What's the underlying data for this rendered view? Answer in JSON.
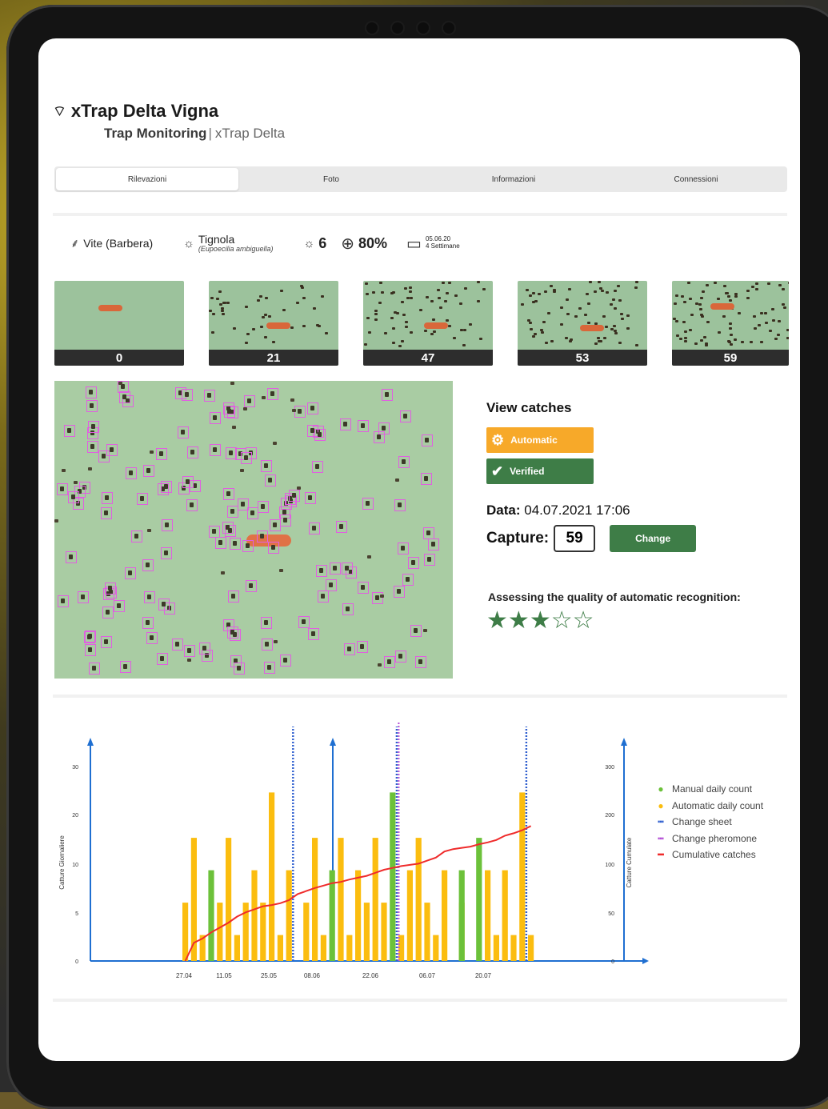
{
  "app": {
    "title": "xTrap Delta Vigna",
    "section": "Trap Monitoring",
    "device": "xTrap Delta"
  },
  "tabs": [
    {
      "label": "Rilevazioni",
      "active": true
    },
    {
      "label": "Foto",
      "active": false
    },
    {
      "label": "Informazioni",
      "active": false
    },
    {
      "label": "Connessioni",
      "active": false
    }
  ],
  "info": {
    "crop": "Vite (Barbera)",
    "pest_name": "Tignola",
    "pest_latin": "(Eupoecilia ambiguella)",
    "pest_count": "6",
    "battery": "80%",
    "date_line1": "05.06.20",
    "date_line2": "4 Settimane"
  },
  "thumbnails": [
    {
      "count": "0"
    },
    {
      "count": "21"
    },
    {
      "count": "47"
    },
    {
      "count": "53"
    },
    {
      "count": "59"
    }
  ],
  "panel": {
    "heading": "View catches",
    "auto_label": "Automatic",
    "verified_label": "Verified",
    "data_label": "Data:",
    "data_value": "04.07.2021 17:06",
    "capture_label": "Capture:",
    "capture_value": "59",
    "change_label": "Change",
    "quality_label": "Assessing the quality of automatic recognition:",
    "rating": 3,
    "rating_max": 5
  },
  "colors": {
    "green": "#3e7d47",
    "orange": "#f7a929",
    "manual": "#6cc13a",
    "automatic": "#fbbd0f",
    "sheet": "#2f5fcf",
    "pheromone": "#b44fd6",
    "cumulative": "#ef2b2b",
    "axis": "#1f6fd1"
  },
  "chart_data": {
    "type": "bar",
    "ylabel_left": "Catture Giornaliere",
    "ylabel_right": "Catture Cumulate",
    "yticks_left": [
      "0",
      "5",
      "10",
      "20",
      "30"
    ],
    "yticks_right": [
      "0",
      "50",
      "100",
      "200",
      "300"
    ],
    "xtick_labels": [
      "27.04",
      "11.05",
      "25.05",
      "08.06",
      "22.06",
      "06.07",
      "20.07"
    ],
    "legend": [
      {
        "label": "Manual daily count",
        "type": "manual"
      },
      {
        "label": "Automatic daily count",
        "type": "automatic"
      },
      {
        "label": "Change sheet",
        "type": "sheet"
      },
      {
        "label": "Change pheromone",
        "type": "pheromone"
      },
      {
        "label": "Cumulative catches",
        "type": "cumulative"
      }
    ],
    "series": [
      {
        "name": "Manual daily count",
        "values": [
          0,
          0,
          0,
          14,
          0,
          0,
          0,
          0,
          0,
          0,
          0,
          0,
          0,
          0,
          0,
          0,
          0,
          14,
          0,
          0,
          0,
          0,
          0,
          0,
          26,
          0,
          0,
          0,
          0,
          0,
          0,
          0,
          14,
          0,
          19,
          0,
          0,
          0,
          0,
          0,
          0
        ]
      },
      {
        "name": "Automatic daily count",
        "values": [
          9,
          19,
          4,
          0,
          9,
          19,
          4,
          9,
          14,
          9,
          26,
          4,
          14,
          0,
          9,
          19,
          4,
          0,
          19,
          4,
          14,
          9,
          19,
          9,
          0,
          4,
          14,
          19,
          9,
          4,
          14,
          0,
          9,
          0,
          0,
          14,
          4,
          14,
          4,
          26,
          4
        ]
      },
      {
        "name": "Cumulative catches",
        "values": [
          0,
          30,
          37,
          47,
          55,
          63,
          73,
          80,
          85,
          90,
          92,
          95,
          100,
          110,
          115,
          120,
          124,
          128,
          130,
          134,
          137,
          140,
          145,
          150,
          153,
          156,
          158,
          160,
          165,
          170,
          180,
          184,
          186,
          188,
          192,
          195,
          199,
          206,
          210,
          215,
          222
        ]
      }
    ],
    "ylim_left": [
      0,
      30
    ],
    "ylim_right": [
      0,
      300
    ],
    "change_sheet_indices": [
      12,
      24,
      39
    ],
    "change_pheromone_indices": [
      24
    ]
  }
}
